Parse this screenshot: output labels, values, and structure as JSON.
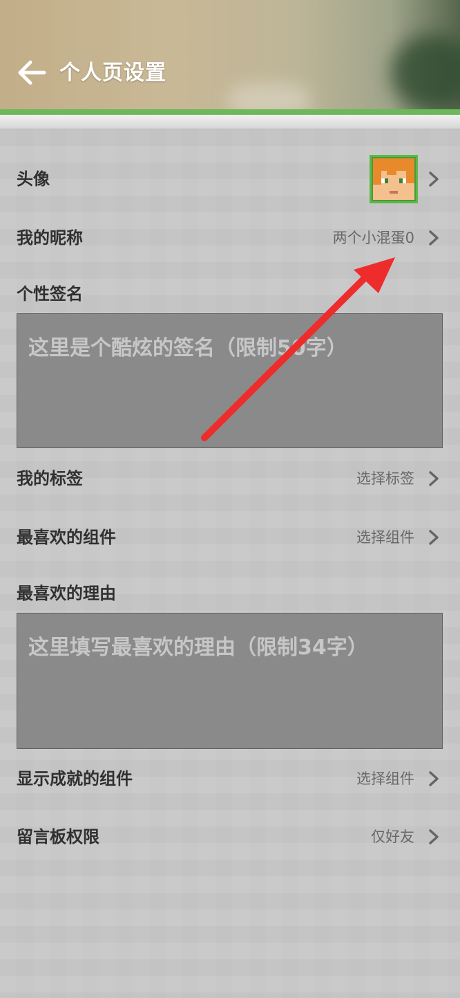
{
  "header": {
    "title": "个人页设置",
    "back_icon": "arrow-left-icon"
  },
  "rows": {
    "avatar": {
      "label": "头像"
    },
    "nickname": {
      "label": "我的昵称",
      "value": "两个小混蛋0"
    },
    "tags": {
      "label": "我的标签",
      "value": "选择标签"
    },
    "favorite_component": {
      "label": "最喜欢的组件",
      "value": "选择组件"
    },
    "achievement_component": {
      "label": "显示成就的组件",
      "value": "选择组件"
    },
    "message_board": {
      "label": "留言板权限",
      "value": "仅好友"
    }
  },
  "signature": {
    "label": "个性签名",
    "placeholder": "这里是个酷炫的签名（限制50字）"
  },
  "reason": {
    "label": "最喜欢的理由",
    "placeholder": "这里填写最喜欢的理由（限制34字）"
  },
  "colors": {
    "accent_green": "#6cb85a",
    "annotation_arrow": "#ee2c2c",
    "textarea_bg": "#8a8a8a",
    "page_bg": "#c8c8c8"
  }
}
